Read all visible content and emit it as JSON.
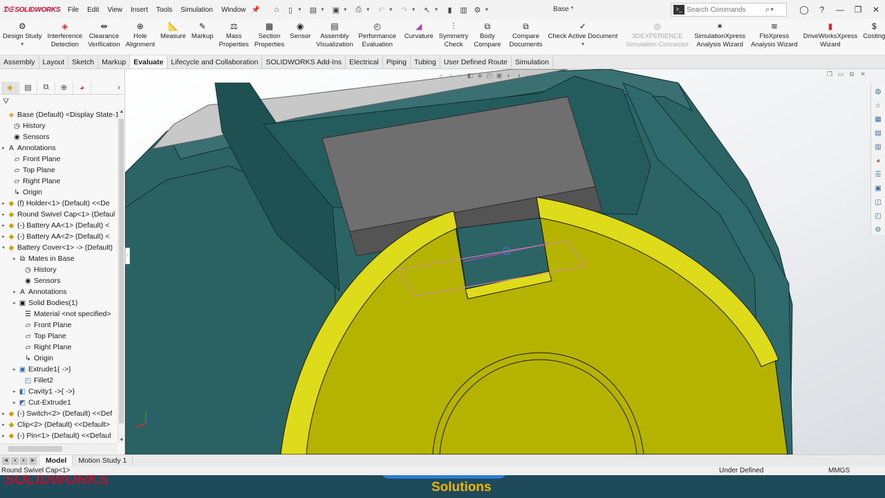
{
  "app": {
    "logo_text": "SOLIDWORKS",
    "document_title": "Base *"
  },
  "menu": [
    "File",
    "Edit",
    "View",
    "Insert",
    "Tools",
    "Simulation",
    "Window"
  ],
  "search": {
    "placeholder": "Search Commands"
  },
  "ribbon": {
    "buttons": [
      {
        "line1": "Design Study",
        "line2": ""
      },
      {
        "line1": "Interference",
        "line2": "Detection"
      },
      {
        "line1": "Clearance",
        "line2": "Verification"
      },
      {
        "line1": "Hole",
        "line2": "Alignment"
      },
      {
        "line1": "Measure",
        "line2": ""
      },
      {
        "line1": "Markup",
        "line2": ""
      },
      {
        "line1": "Mass",
        "line2": "Properties"
      },
      {
        "line1": "Section",
        "line2": "Properties"
      },
      {
        "line1": "Sensor",
        "line2": ""
      },
      {
        "line1": "Assembly",
        "line2": "Visualization"
      },
      {
        "line1": "Performance",
        "line2": "Evaluation"
      },
      {
        "line1": "Curvature",
        "line2": ""
      },
      {
        "line1": "Symmetry",
        "line2": "Check"
      },
      {
        "line1": "Body",
        "line2": "Compare"
      },
      {
        "line1": "Compare",
        "line2": "Documents"
      },
      {
        "line1": "Check Active Document",
        "line2": ""
      },
      {
        "line1": "3DEXPERIENCE",
        "line2": "Simulation Connector"
      },
      {
        "line1": "SimulationXpress",
        "line2": "Analysis Wizard"
      },
      {
        "line1": "FloXpress",
        "line2": "Analysis Wizard"
      },
      {
        "line1": "DriveWorksXpress",
        "line2": "Wizard"
      },
      {
        "line1": "Costing",
        "line2": ""
      }
    ]
  },
  "tabs": [
    "Assembly",
    "Layout",
    "Sketch",
    "Markup",
    "Evaluate",
    "Lifecycle and Collaboration",
    "SOLIDWORKS Add-Ins",
    "Electrical",
    "Piping",
    "Tubing",
    "User Defined Route",
    "Simulation"
  ],
  "active_tab": "Evaluate",
  "tree": [
    {
      "label": "Base (Default) <Display State-1>",
      "icon": "assembly-icon"
    },
    {
      "label": "History",
      "icon": "history-icon"
    },
    {
      "label": "Sensors",
      "icon": "sensor-icon"
    },
    {
      "label": "Annotations",
      "icon": "annotation-icon"
    },
    {
      "label": "Front Plane",
      "icon": "plane-icon"
    },
    {
      "label": "Top Plane",
      "icon": "plane-icon"
    },
    {
      "label": "Right Plane",
      "icon": "plane-icon"
    },
    {
      "label": "Origin",
      "icon": "origin-icon"
    },
    {
      "label": "(f) Holder<1> (Default) <<De",
      "icon": "part-icon"
    },
    {
      "label": "Round Swivel Cap<1> (Defaul",
      "icon": "part-icon"
    },
    {
      "label": "(-) Battery AA<1> (Default) <",
      "icon": "part-icon"
    },
    {
      "label": "(-) Battery AA<2> (Default) <",
      "icon": "part-icon"
    },
    {
      "label": "Battery Cover<1> -> (Default)",
      "icon": "part-icon"
    },
    {
      "label": "Mates in Base",
      "icon": "mates-icon"
    },
    {
      "label": "History",
      "icon": "history-icon"
    },
    {
      "label": "Sensors",
      "icon": "sensor-icon"
    },
    {
      "label": "Annotations",
      "icon": "annotation-icon"
    },
    {
      "label": "Solid Bodies(1)",
      "icon": "solid-bodies-icon"
    },
    {
      "label": "Material <not specified>",
      "icon": "material-icon"
    },
    {
      "label": "Front Plane",
      "icon": "plane-icon"
    },
    {
      "label": "Top Plane",
      "icon": "plane-icon"
    },
    {
      "label": "Right Plane",
      "icon": "plane-icon"
    },
    {
      "label": "Origin",
      "icon": "origin-icon"
    },
    {
      "label": "Extrude1{ ->}",
      "icon": "extrude-icon"
    },
    {
      "label": "Fillet2",
      "icon": "fillet-icon"
    },
    {
      "label": "Cavity1 ->{ ->}",
      "icon": "cavity-icon"
    },
    {
      "label": "Cut-Extrude1",
      "icon": "cut-extrude-icon"
    },
    {
      "label": "(-) Switch<2> (Default) <<Def",
      "icon": "part-icon"
    },
    {
      "label": "Clip<2> (Default) <<Default>",
      "icon": "part-icon"
    },
    {
      "label": "(-) Pin<1> (Default) <<Defaul",
      "icon": "part-icon"
    }
  ],
  "bottom_tabs": [
    "Model",
    "Motion Study 1"
  ],
  "status": {
    "left": "Round Swivel Cap<1>",
    "middle": "Under Defined",
    "right": "MMGS"
  },
  "watermark": {
    "left": "SOLIDWORKS",
    "right": "Solutions"
  },
  "colors": {
    "teal": "#215a5c",
    "teal_dark": "#163f40",
    "yellow": "#b8b300",
    "yellow_bright": "#e2dd10",
    "gray_block": "#6d6d6d",
    "brand_red": "#c8102e"
  }
}
